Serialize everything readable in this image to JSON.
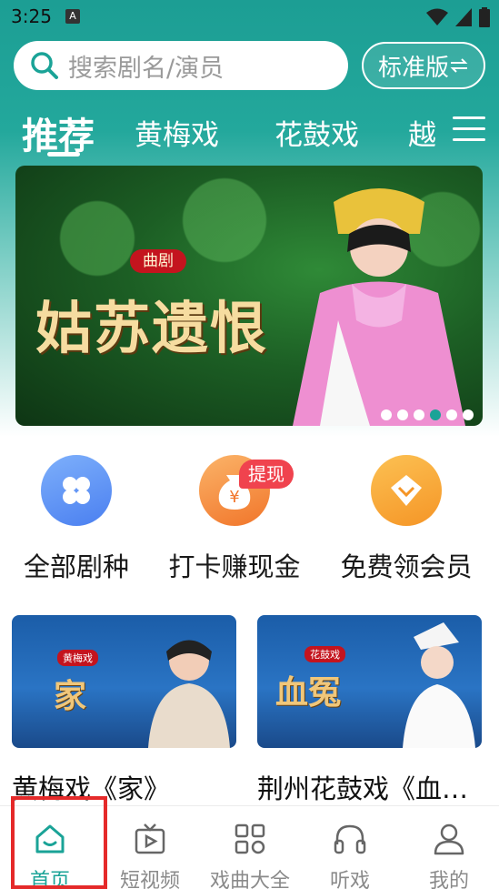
{
  "status_bar": {
    "time": "3:25",
    "notification_icon": "A"
  },
  "search": {
    "placeholder": "搜索剧名/演员",
    "edition_label": "标准版"
  },
  "tabs": [
    {
      "label": "推荐",
      "active": true
    },
    {
      "label": "黄梅戏"
    },
    {
      "label": "花鼓戏"
    },
    {
      "label": "越"
    }
  ],
  "banner": {
    "badge": "曲剧",
    "title": "姑苏遗恨",
    "dot_count": 6,
    "active_dot": 3
  },
  "quick_entries": [
    {
      "label": "全部剧种",
      "icon": "clover-icon",
      "color": "#5a8ff5"
    },
    {
      "label": "打卡赚现金",
      "icon": "money-bag-icon",
      "color": "#f59a3c",
      "badge": "提现"
    },
    {
      "label": "免费领会员",
      "icon": "vip-diamond-icon",
      "color": "#f8a030"
    }
  ],
  "cards": [
    {
      "title": "黄梅戏《家》",
      "tag": "黄梅戏",
      "art_text": "家"
    },
    {
      "title": "荆州花鼓戏《血…",
      "tag": "花鼓戏",
      "art_text": "血冤"
    }
  ],
  "bottom_nav": [
    {
      "label": "首页",
      "icon": "home-icon",
      "active": true
    },
    {
      "label": "短视频",
      "icon": "tv-play-icon"
    },
    {
      "label": "戏曲大全",
      "icon": "grid-icon"
    },
    {
      "label": "听戏",
      "icon": "headphones-icon"
    },
    {
      "label": "我的",
      "icon": "user-icon"
    }
  ],
  "colors": {
    "accent": "#1aa397",
    "header": "#23a89c",
    "highlight": "#e52a2a"
  }
}
